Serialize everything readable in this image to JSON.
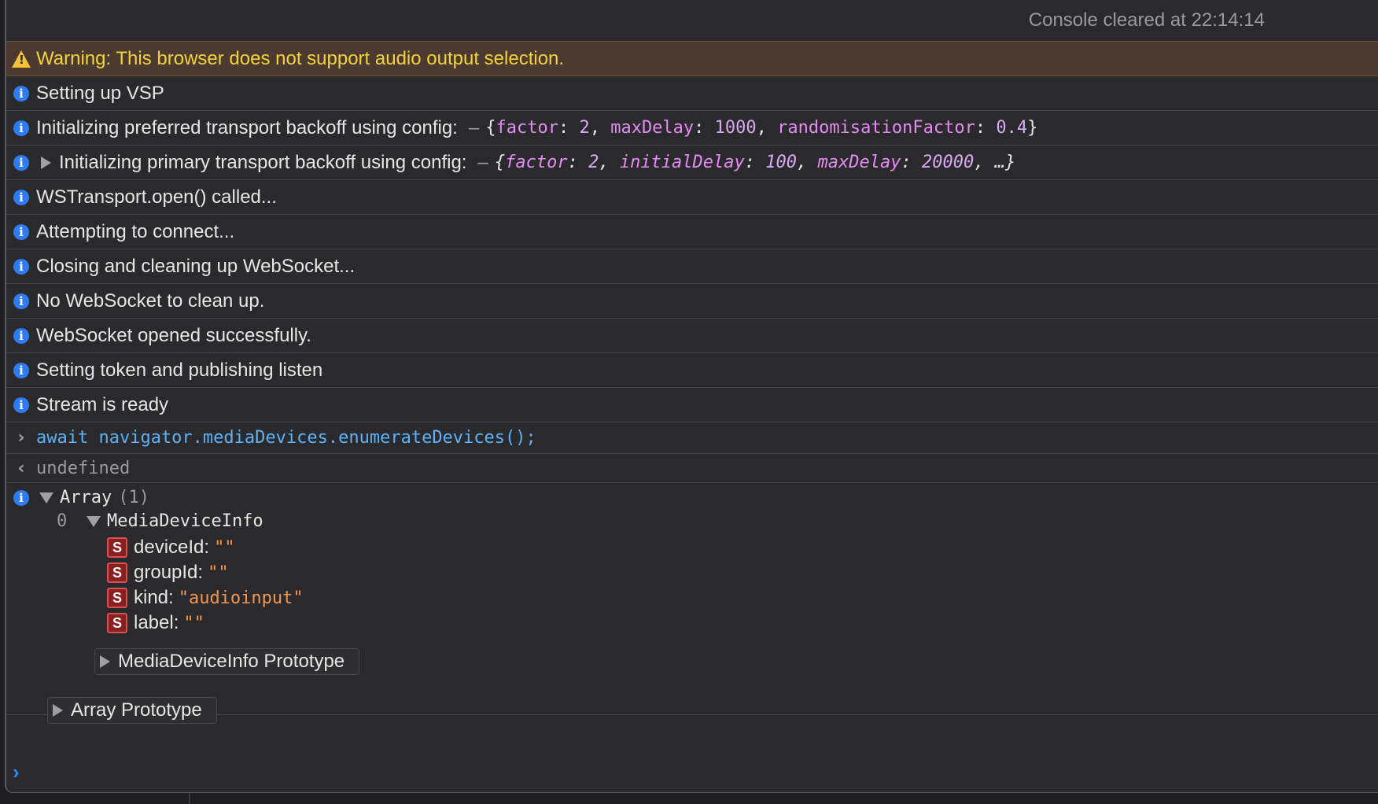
{
  "header": {
    "cleared_text": "Console cleared at 22:14:14"
  },
  "warning": {
    "text": "Warning: This browser does not support audio output selection."
  },
  "logs": {
    "l1": "Setting up VSP",
    "l2_text": "Initializing preferred transport backoff using config:",
    "l2_obj": {
      "k1": "factor",
      "v1": "2",
      "k2": "maxDelay",
      "v2": "1000",
      "k3": "randomisationFactor",
      "v3": "0.4"
    },
    "l3_text": "Initializing primary transport backoff using config:",
    "l3_obj": {
      "k1": "factor",
      "v1": "2",
      "k2": "initialDelay",
      "v2": "100",
      "k3": "maxDelay",
      "v3": "20000",
      "more": "…"
    },
    "l4": "WSTransport.open() called...",
    "l5": "Attempting to connect...",
    "l6": "Closing and cleaning up WebSocket...",
    "l7": "No WebSocket to clean up.",
    "l8": "WebSocket opened successfully.",
    "l9": "Setting token and publishing listen",
    "l10": "Stream is ready"
  },
  "input": {
    "code": "await navigator.mediaDevices.enumerateDevices();"
  },
  "result": {
    "value": "undefined"
  },
  "array": {
    "label": "Array",
    "count": "(1)",
    "index": "0",
    "item_type": "MediaDeviceInfo",
    "props": [
      {
        "name": "deviceId:",
        "value": "\"\""
      },
      {
        "name": "groupId:",
        "value": "\"\""
      },
      {
        "name": "kind:",
        "value": "\"audioinput\""
      },
      {
        "name": "label:",
        "value": "\"\""
      }
    ],
    "badge": "S",
    "item_proto": "MediaDeviceInfo Prototype",
    "array_proto": "Array Prototype"
  },
  "colors": {
    "info": "#2f7bf6",
    "warning": "#f5d23b",
    "string": "#f59650",
    "code": "#5eb1f7"
  }
}
